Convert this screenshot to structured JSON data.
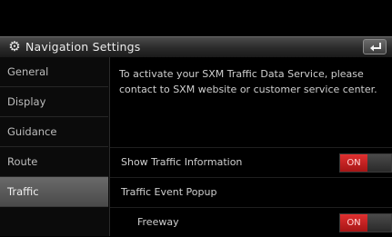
{
  "header": {
    "title": "Navigation Settings",
    "icon": "gear-icon",
    "back_icon": "back-arrow-icon"
  },
  "sidebar": {
    "items": [
      {
        "label": "General"
      },
      {
        "label": "Display"
      },
      {
        "label": "Guidance"
      },
      {
        "label": "Route"
      },
      {
        "label": "Traffic"
      }
    ],
    "active_index": 4
  },
  "content": {
    "info_text": "To activate your SXM Traffic Data Service, please contact to SXM website or customer service center.",
    "rows": [
      {
        "label": "Show Traffic Information",
        "toggle": "ON"
      },
      {
        "label": "Traffic Event Popup"
      },
      {
        "label": "Freeway",
        "toggle": "ON"
      }
    ]
  },
  "colors": {
    "accent_on": "#c41e1e",
    "background": "#000000"
  }
}
